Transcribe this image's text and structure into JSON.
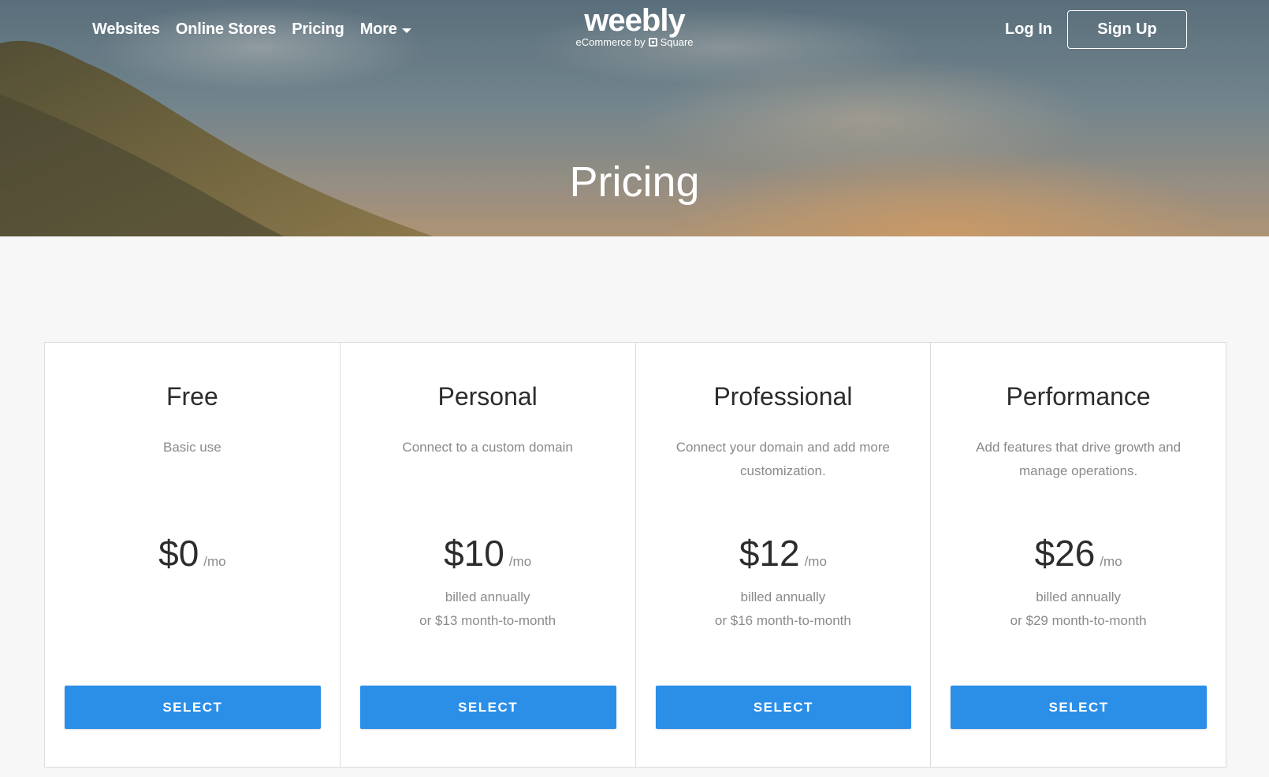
{
  "header": {
    "nav": [
      {
        "label": "Websites"
      },
      {
        "label": "Online Stores"
      },
      {
        "label": "Pricing"
      },
      {
        "label": "More",
        "has_dropdown": true
      }
    ],
    "logo": {
      "wordmark": "weebly",
      "tagline_prefix": "eCommerce by",
      "tagline_brand": "Square"
    },
    "login_label": "Log In",
    "signup_label": "Sign Up"
  },
  "hero": {
    "title": "Pricing"
  },
  "plans": [
    {
      "name": "Free",
      "description": "Basic use",
      "price": "$0",
      "unit": "/mo",
      "billing_line1": "",
      "billing_line2": "",
      "button": "SELECT"
    },
    {
      "name": "Personal",
      "description": "Connect to a custom domain",
      "price": "$10",
      "unit": "/mo",
      "billing_line1": "billed annually",
      "billing_line2": "or $13 month-to-month",
      "button": "SELECT"
    },
    {
      "name": "Professional",
      "description": "Connect your domain and add more customization.",
      "price": "$12",
      "unit": "/mo",
      "billing_line1": "billed annually",
      "billing_line2": "or $16 month-to-month",
      "button": "SELECT"
    },
    {
      "name": "Performance",
      "description": "Add features that drive growth and manage operations.",
      "price": "$26",
      "unit": "/mo",
      "billing_line1": "billed annually",
      "billing_line2": "or $29 month-to-month",
      "button": "SELECT"
    }
  ],
  "colors": {
    "accent": "#2b8fe8",
    "background": "#f7f7f7",
    "muted_text": "#8a8a8a"
  }
}
